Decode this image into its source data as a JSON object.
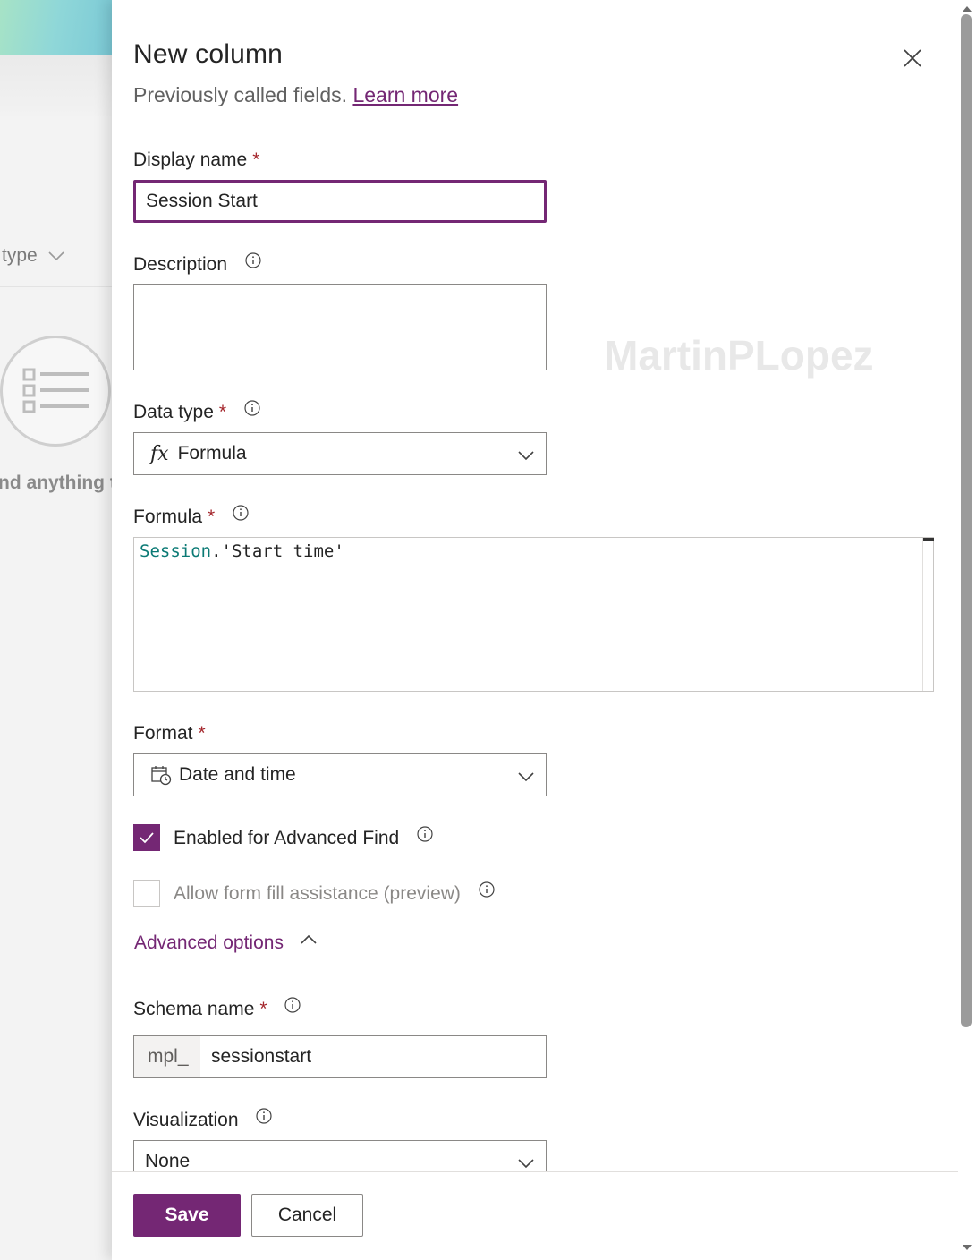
{
  "backdrop": {
    "column_header": "type",
    "empty_text": "nd anything t"
  },
  "panel": {
    "title": "New column",
    "subtitle": "Previously called fields.",
    "learn_more": "Learn more",
    "watermark": "MartinPLopez"
  },
  "fields": {
    "display_name": {
      "label": "Display name",
      "required": "*",
      "value": "Session Start"
    },
    "description": {
      "label": "Description",
      "value": ""
    },
    "data_type": {
      "label": "Data type",
      "required": "*",
      "icon": "fx-icon",
      "fx": "fx",
      "value": "Formula"
    },
    "formula": {
      "label": "Formula",
      "required": "*",
      "ident": "Session",
      "dot": ".",
      "string": "'Start time'"
    },
    "format": {
      "label": "Format",
      "required": "*",
      "icon": "calendar-clock-icon",
      "value": "Date and time"
    },
    "advanced_find": {
      "label": "Enabled for Advanced Find",
      "checked": true
    },
    "form_fill": {
      "label": "Allow form fill assistance (preview)",
      "checked": false
    },
    "advanced_options": {
      "label": "Advanced options"
    },
    "schema_name": {
      "label": "Schema name",
      "required": "*",
      "prefix": "mpl_",
      "value": "sessionstart"
    },
    "visualization": {
      "label": "Visualization",
      "value": "None"
    }
  },
  "footer": {
    "save": "Save",
    "cancel": "Cancel"
  },
  "colors": {
    "accent": "#742774",
    "required": "#a4262c",
    "formula_ident": "#0b7a75"
  }
}
